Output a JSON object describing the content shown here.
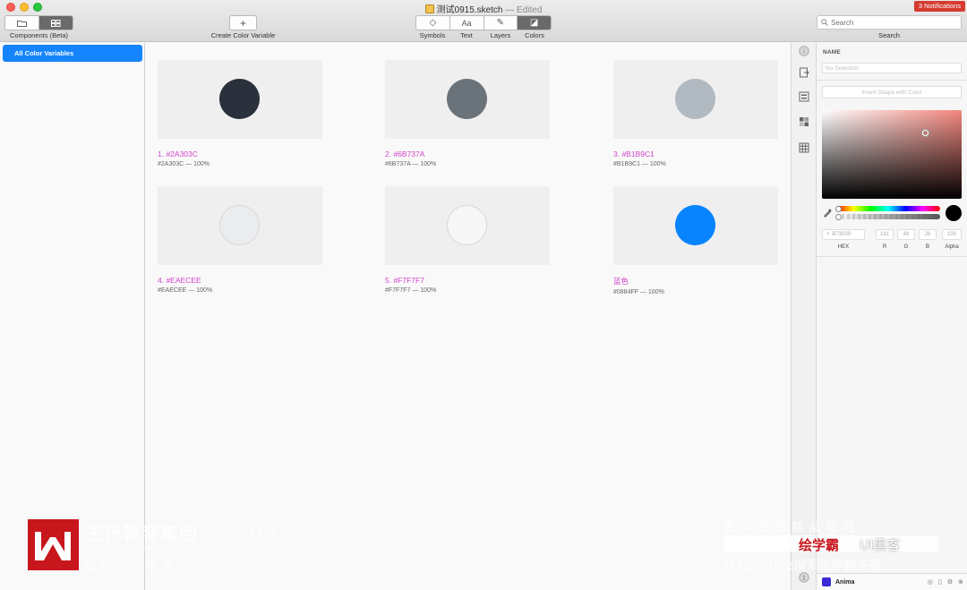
{
  "window": {
    "title": "测试0915.sketch",
    "title_suffix": "— Edited",
    "notifications": "3 Notifications"
  },
  "toolbar": {
    "components_label": "Components (Beta)",
    "create_label": "Create Color Variable",
    "create_glyph": "+",
    "tabs": [
      {
        "label": "Symbols",
        "glyph": "◇"
      },
      {
        "label": "Text",
        "glyph": "Aa"
      },
      {
        "label": "Layers",
        "glyph": "✎"
      },
      {
        "label": "Colors",
        "glyph": "◪"
      }
    ],
    "search_placeholder": "Search",
    "search_label": "Search"
  },
  "sidebar": {
    "items": [
      {
        "label": "All Color Variables"
      }
    ]
  },
  "colors": [
    {
      "name": "1. #2A303C",
      "meta": "#2A303C — 100%",
      "hex": "#2A303C"
    },
    {
      "name": "2. #6B737A",
      "meta": "#6B737A — 100%",
      "hex": "#6B737A"
    },
    {
      "name": "3. #B1B9C1",
      "meta": "#B1B9C1 — 100%",
      "hex": "#B1B9C1"
    },
    {
      "name": "4. #EAECEE",
      "meta": "#EAECEE — 100%",
      "hex": "#EAECEE"
    },
    {
      "name": "5. #F7F7F7",
      "meta": "#F7F7F7 — 100%",
      "hex": "#F7F7F7"
    },
    {
      "name": "蓝色",
      "meta": "#0884FF — 100%",
      "hex": "#0884FF"
    }
  ],
  "inspector": {
    "name_label": "NAME",
    "name_placeholder": "No Selection",
    "insert_button": "Insert Shape with Color",
    "hex_value": "B73030",
    "r": "181",
    "g": "48",
    "b": "26",
    "alpha": "100",
    "hex_label": "HEX",
    "r_label": "R",
    "g_label": "G",
    "b_label": "B",
    "alpha_label": "Alpha"
  },
  "plugin": {
    "name": "Anima"
  },
  "watermark": {
    "brand": "王氏教育集团",
    "slogan": "以人为本",
    "subtitle": "始 创 于 二 零 零 二 年",
    "right_top": "更 多 免 费 精 品 教 程",
    "right_brand_red": "绘学霸",
    "right_brand": "UI黑客",
    "right_bottom": "在AppStore搜索绘学霸下载"
  }
}
